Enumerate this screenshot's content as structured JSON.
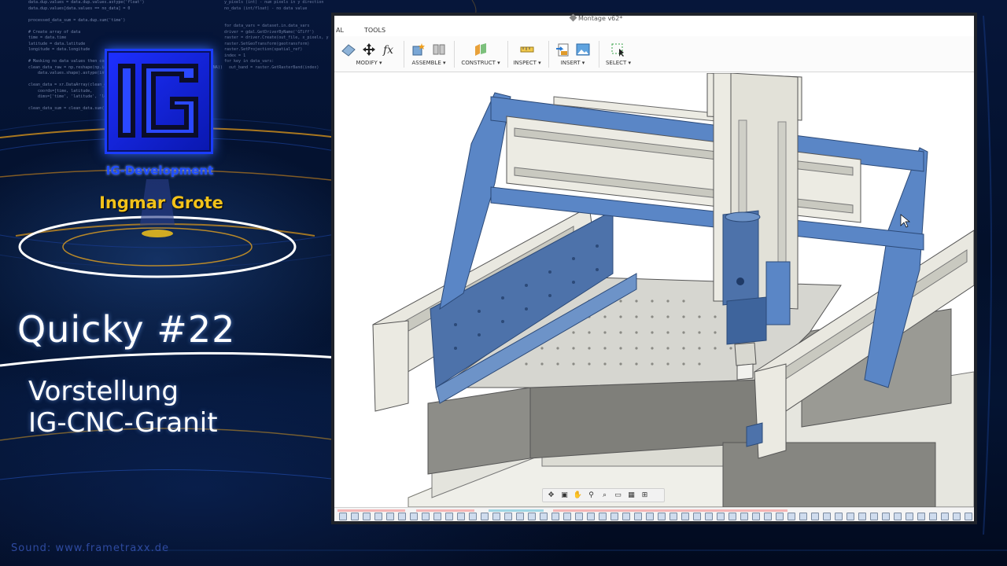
{
  "promo": {
    "logo_caption": "IG-Development",
    "author": "Ingmar Grote",
    "episode_title": "Quicky #22",
    "subtitle_line1": "Vorstellung",
    "subtitle_line2": "IG-CNC-Granit",
    "sound_credit": "Sound: www.frametraxx.de"
  },
  "cad": {
    "window_title": "Montage v62*",
    "tabs": [
      "AL",
      "TOOLS"
    ],
    "toolbar_groups": [
      {
        "label": "MODIFY ▾"
      },
      {
        "label": "ASSEMBLE ▾"
      },
      {
        "label": "CONSTRUCT ▾"
      },
      {
        "label": "INSPECT ▾"
      },
      {
        "label": "INSERT ▾"
      },
      {
        "label": "SELECT ▾"
      }
    ]
  },
  "colors": {
    "accent_blue": "#5a86c6",
    "frame_gray": "#e8e7df",
    "granite": "#8c8c8c",
    "logo_blue": "#1f4dff",
    "author_yellow": "#f2c21a"
  }
}
